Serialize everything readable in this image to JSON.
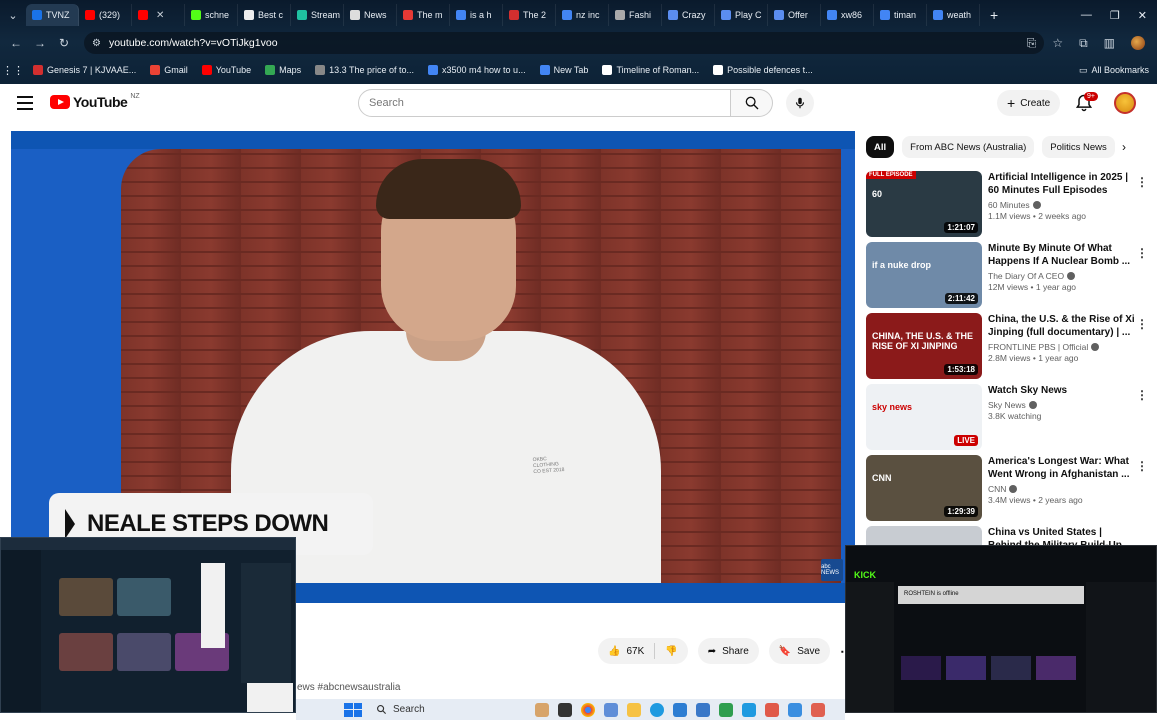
{
  "browser": {
    "tabs": [
      {
        "label": "TVNZ",
        "color": "#1a73e8"
      },
      {
        "label": "(329)",
        "color": "#ff0000"
      },
      {
        "label": "",
        "color": "#ff0000"
      },
      {
        "label": "schne",
        "color": "#53fc18"
      },
      {
        "label": "Best c",
        "color": "#eeeeee"
      },
      {
        "label": "Stream",
        "color": "#1fc1a0"
      },
      {
        "label": "News",
        "color": "#dddddd"
      },
      {
        "label": "The m",
        "color": "#e53935"
      },
      {
        "label": "is a h",
        "color": "#4285f4"
      },
      {
        "label": "The 2",
        "color": "#d32f2f"
      },
      {
        "label": "nz inc",
        "color": "#4285f4"
      },
      {
        "label": "Fashi",
        "color": "#aaaaaa"
      },
      {
        "label": "Crazy",
        "color": "#5b8def"
      },
      {
        "label": "Play C",
        "color": "#5b8def"
      },
      {
        "label": "Offer",
        "color": "#5b8def"
      },
      {
        "label": "xw86",
        "color": "#4285f4"
      },
      {
        "label": "timan",
        "color": "#4285f4"
      },
      {
        "label": "weath",
        "color": "#4285f4"
      }
    ],
    "url": "youtube.com/watch?v=vOTiJkg1voo",
    "bookmarks": [
      {
        "label": "Genesis 7 | KJVAAE...",
        "color": "#d32f2f"
      },
      {
        "label": "Gmail",
        "color": "#ea4335"
      },
      {
        "label": "YouTube",
        "color": "#ff0000"
      },
      {
        "label": "Maps",
        "color": "#34a853"
      },
      {
        "label": "13.3 The price of to...",
        "color": "#888888"
      },
      {
        "label": "x3500 m4 how to u...",
        "color": "#4285f4"
      },
      {
        "label": "New Tab",
        "color": "#4285f4"
      },
      {
        "label": "Timeline of Roman...",
        "color": "#ffffff"
      },
      {
        "label": "Possible defences t...",
        "color": "#ffffff"
      }
    ],
    "bookmarks_folder": "All Bookmarks"
  },
  "youtube": {
    "logo_text": "YouTube",
    "region": "NZ",
    "search_placeholder": "Search",
    "create_label": "Create",
    "bell_badge": "9+",
    "player": {
      "lower_third": "NEALE STEPS DOWN",
      "shirt_text_1": "OKBC",
      "shirt_text_2": "CLOTHING",
      "shirt_text_3": "CO EST 2018",
      "channel_logo": "abc NEWS"
    },
    "actions": {
      "like_count": "67K",
      "share_label": "Share",
      "save_label": "Save"
    },
    "hashtag": "ews #abcnewsaustralia",
    "chips": [
      {
        "label": "All",
        "active": true
      },
      {
        "label": "From ABC News (Australia)",
        "active": false
      },
      {
        "label": "Politics News",
        "active": false
      }
    ],
    "related": [
      {
        "title": "Artificial Intelligence in 2025 | 60 Minutes Full Episodes",
        "channel": "60 Minutes",
        "stats": "1.1M views • 2 weeks ago",
        "duration": "1:21:07",
        "badge": "FULL EPISODE",
        "thumb_text": "60",
        "thumb_color": "#2a3a44"
      },
      {
        "title": "Minute By Minute Of What Happens If A Nuclear Bomb ...",
        "channel": "The Diary Of A CEO",
        "stats": "12M views • 1 year ago",
        "duration": "2:11:42",
        "badge": "",
        "thumb_text": "if a nuke drop",
        "thumb_color": "#6f8aa8"
      },
      {
        "title": "China, the U.S. & the Rise of Xi Jinping (full documentary) | ...",
        "channel": "FRONTLINE PBS | Official",
        "stats": "2.8M views • 1 year ago",
        "duration": "1:53:18",
        "badge": "",
        "thumb_text": "CHINA, THE U.S. & THE RISE OF XI JINPING",
        "thumb_color": "#8b1a1a"
      },
      {
        "title": "Watch Sky News",
        "channel": "Sky News",
        "stats": "3.8K watching",
        "duration": "LIVE",
        "badge": "",
        "thumb_text": "sky news",
        "thumb_color": "#eef1f4"
      },
      {
        "title": "America's Longest War: What Went Wrong in Afghanistan ...",
        "channel": "CNN",
        "stats": "3.4M views • 2 years ago",
        "duration": "1:29:39",
        "badge": "",
        "thumb_text": "CNN",
        "thumb_color": "#5a5040"
      },
      {
        "title": "China vs United States | Behind the Military Build-Up",
        "channel": "",
        "stats": "",
        "duration": "",
        "badge": "",
        "thumb_text": "",
        "thumb_color": "#c8ccd2"
      }
    ]
  },
  "overlays": {
    "right_label": "KICK",
    "right_offline": "ROSHTEIN is offline"
  },
  "taskbar": {
    "search_label": "Search"
  }
}
